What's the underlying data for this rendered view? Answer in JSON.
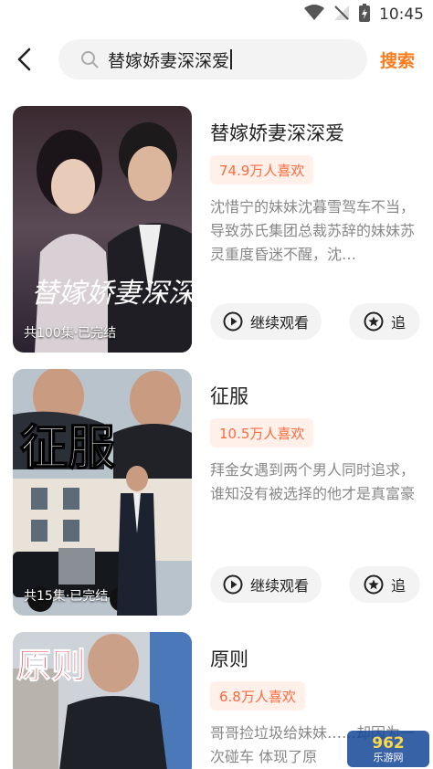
{
  "status_bar": {
    "time": "10:45"
  },
  "search": {
    "query": "替嫁娇妻深深爱",
    "submit_label": "搜索"
  },
  "results": [
    {
      "poster_caption": "共100集·已完结",
      "poster_art_text": "替嫁娇妻深深爱",
      "title": "替嫁娇妻深深爱",
      "likes": "74.9万人喜欢",
      "description": "沈惜宁的妹妹沈暮雪驾车不当，导致苏氏集团总裁苏辞的妹妹苏灵重度昏迷不醒，沈…",
      "watch_label": "继续观看",
      "follow_label": "追"
    },
    {
      "poster_caption": "共15集·已完结",
      "poster_art_text": "征服",
      "title": "征服",
      "likes": "10.5万人喜欢",
      "description": "拜金女遇到两个男人同时追求，谁知没有被选择的他才是真富豪",
      "watch_label": "继续观看",
      "follow_label": "追"
    },
    {
      "poster_art_text": "原则",
      "title": "原则",
      "likes": "6.8万人喜欢",
      "description": "哥哥捡垃圾给妹妹……却因为一次碰车 体现了原"
    }
  ],
  "watermark": {
    "brand": "962",
    "site": "乐游网"
  },
  "colors": {
    "accent": "#ff7a1a",
    "likes_bg": "#fff0ea",
    "likes_text": "#ff6a3d"
  }
}
